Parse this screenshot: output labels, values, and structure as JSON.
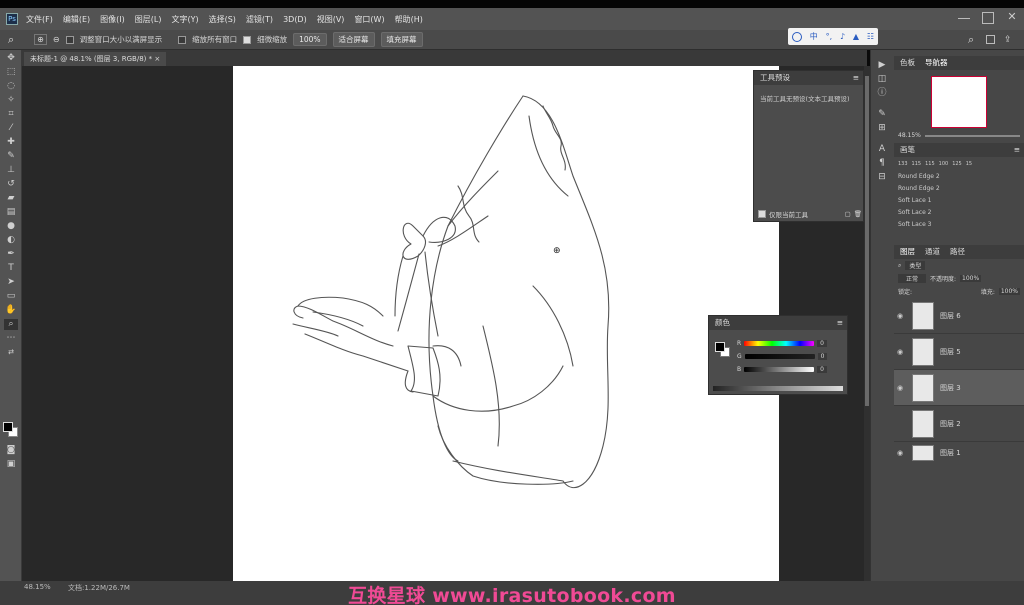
{
  "window": {
    "title": "未标题-1 @ 48.1% (图层 3, RGB/8) *"
  },
  "menu": [
    "文件(F)",
    "编辑(E)",
    "图像(I)",
    "图层(L)",
    "文字(Y)",
    "选择(S)",
    "滤镜(T)",
    "3D(D)",
    "视图(V)",
    "窗口(W)",
    "帮助(H)"
  ],
  "options": {
    "resize_windows": "调整窗口大小以满屏显示",
    "zoom_all": "缩放所有窗口",
    "scrubby": "细微缩放",
    "zoom_100": "100%",
    "fit_screen": "适合屏幕",
    "fill_screen": "填充屏幕"
  },
  "ime": {
    "items": [
      "中",
      "°,",
      "♪",
      "▲",
      "☷"
    ]
  },
  "tool_presets": {
    "title": "工具预设",
    "message": "当前工具无预设(文本工具预设)",
    "checkbox": "仅限当前工具"
  },
  "color_panel": {
    "title": "颜色",
    "r": "0",
    "g": "0",
    "b": "0"
  },
  "navigator": {
    "tabs": [
      "色板",
      "导航器"
    ],
    "zoom": "48.15%"
  },
  "brushes": {
    "title": "画笔",
    "sizes": [
      "133",
      "115",
      "115",
      "100",
      "125",
      "15"
    ],
    "items": [
      "Round Edge 2",
      "Round Edge 2",
      "Soft Lace 1",
      "Soft Lace 2",
      "Soft Lace 3"
    ]
  },
  "layers": {
    "tabs": [
      "图层",
      "通道",
      "路径"
    ],
    "filter": "类型",
    "blend_mode": "正常",
    "opacity_label": "不透明度:",
    "opacity": "100%",
    "lock_label": "锁定:",
    "fill_label": "填充:",
    "fill": "100%",
    "items": [
      {
        "name": "图层 6",
        "selected": false
      },
      {
        "name": "图层 5",
        "selected": false
      },
      {
        "name": "图层 3",
        "selected": true
      },
      {
        "name": "图层 2",
        "selected": false
      },
      {
        "name": "图层 1",
        "selected": false
      }
    ]
  },
  "status": {
    "zoom": "48.15%",
    "doc": "文档:1.22M/26.7M"
  },
  "watermark": "互换星球 www.irasutobook.com"
}
